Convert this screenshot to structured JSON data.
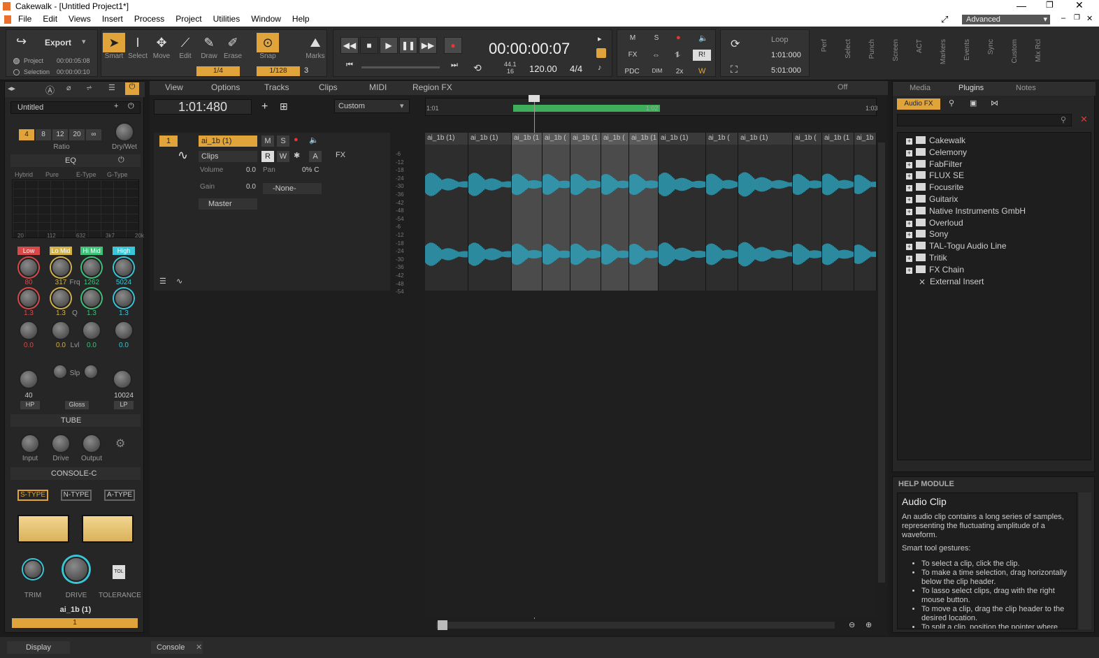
{
  "window": {
    "title": "Cakewalk - [Untitled Project1*]"
  },
  "menu": [
    "File",
    "Edit",
    "Views",
    "Insert",
    "Process",
    "Project",
    "Utilities",
    "Window",
    "Help"
  ],
  "workspace": "Advanced",
  "control": {
    "export_label": "Export",
    "project_label": "Project",
    "project_time": "00:00:05:08",
    "selection_label": "Selection",
    "selection_time": "00:00:00:10",
    "tools": [
      "Smart",
      "Select",
      "Move",
      "Edit",
      "Draw",
      "Erase"
    ],
    "snap_label": "Snap",
    "marks_label": "Marks",
    "draw_res": "1/4",
    "snap_res": "1/128",
    "snap_num": "3",
    "time": "00:00:00:07",
    "sample_rate": "44.1",
    "bit_depth": "16",
    "tempo": "120.00",
    "meter": "4/4",
    "mix_buttons": [
      "M",
      "S",
      "FX",
      "PDC",
      "DIM",
      "2x",
      "R!"
    ],
    "loop_label": "Loop",
    "loop_start": "1:01:000",
    "loop_end": "5:01:000",
    "vtabs": [
      "Perf",
      "Select",
      "Punch",
      "Screen",
      "ACT",
      "Markers",
      "Events",
      "Sync",
      "Custom",
      "Mix Rcl"
    ]
  },
  "inspector": {
    "project_name": "Untitled",
    "ratio_buttons": [
      "4",
      "8",
      "12",
      "20",
      "∞"
    ],
    "ratio_label": "Ratio",
    "drywet_label": "Dry/Wet",
    "eq_label": "EQ",
    "eq_modes": [
      "Hybrid",
      "Pure",
      "E-Type",
      "G-Type"
    ],
    "eq_freq_ticks": [
      "20",
      "112",
      "632",
      "3k7",
      "20k"
    ],
    "bands": [
      "Low",
      "Lo Mid",
      "Hi Mid",
      "High"
    ],
    "band_colors": [
      "#d84a4a",
      "#d2b24a",
      "#3ec27a",
      "#39c6d6"
    ],
    "freq_values": [
      "80",
      "317",
      "1262",
      "5024"
    ],
    "freq_label": "Frq",
    "q_values": [
      "1.3",
      "1.3",
      "1.3",
      "1.3"
    ],
    "q_label": "Q",
    "lvl_values": [
      "0.0",
      "0.0",
      "0.0",
      "0.0"
    ],
    "lvl_label": "Lvl",
    "slp_label": "Slp",
    "hp_value": "40",
    "lp_value": "10024",
    "hp_label": "HP",
    "gloss_label": "Gloss",
    "lp_label": "LP",
    "tube_label": "TUBE",
    "tube_knobs": [
      "Input",
      "Drive",
      "Output"
    ],
    "console_label": "CONSOLE-C",
    "console_types": [
      "S-TYPE",
      "N-TYPE",
      "A-TYPE"
    ],
    "bottom_knobs": [
      "TRIM",
      "DRIVE",
      "TOLERANCE"
    ],
    "tol_label": "TOL",
    "track_name": "ai_1b (1)",
    "track_number": "1",
    "display_tab": "Display"
  },
  "tracks": {
    "time_display": "1:01:480",
    "menus": [
      "View",
      "Options",
      "Tracks",
      "Clips",
      "MIDI",
      "Region FX"
    ],
    "preset": "Custom",
    "off_label": "Off",
    "ruler_start": "1:01",
    "ruler_mid": "1:02",
    "ruler_end": "1:03",
    "track": {
      "number": "1",
      "name": "ai_1b (1)",
      "clips_label": "Clips",
      "fx_label": "FX",
      "volume_label": "Volume",
      "volume": "0.0",
      "pan_label": "Pan",
      "pan": "0% C",
      "gain_label": "Gain",
      "gain": "0.0",
      "input": "-None-",
      "output": "Master",
      "buttons": [
        "M",
        "S",
        "R",
        "W",
        "A"
      ]
    },
    "db_scale": [
      "-6",
      "-12",
      "-18",
      "-24",
      "-30",
      "-36",
      "-42",
      "-48",
      "-54",
      "-6",
      "-12",
      "-18",
      "-24",
      "-30",
      "-36",
      "-42",
      "-48",
      "-54"
    ],
    "clips": [
      {
        "label": "ai_1b (1)"
      },
      {
        "label": "ai_1b (1)"
      },
      {
        "label": "ai_1b (1"
      },
      {
        "label": "ai_1b ("
      },
      {
        "label": "ai_1b (1"
      },
      {
        "label": "ai_1b ("
      },
      {
        "label": "ai_1b (1"
      },
      {
        "label": "ai_1b (1)"
      },
      {
        "label": "ai_1b ("
      },
      {
        "label": "ai_1b (1)"
      },
      {
        "label": "ai_1b ("
      },
      {
        "label": "ai_1b (1"
      },
      {
        "label": "ai_1b"
      }
    ]
  },
  "browser": {
    "tabs": [
      "Media",
      "Plugins",
      "Notes"
    ],
    "subtab": "Audio FX",
    "items": [
      "Cakewalk",
      "Celemony",
      "FabFilter",
      "FLUX SE",
      "Focusrite",
      "Guitarix",
      "Native Instruments GmbH",
      "Overloud",
      "Sony",
      "TAL-Togu Audio Line",
      "Tritik",
      "FX Chain",
      "External Insert"
    ]
  },
  "help": {
    "header": "HELP MODULE",
    "title": "Audio Clip",
    "body": "An audio clip contains a long series of samples, representing the fluctuating amplitude of a waveform.",
    "sub": "Smart tool gestures:",
    "bullets": [
      "To select a clip, click the clip.",
      "To make a time selection, drag horizontally below the clip header.",
      "To lasso select clips, drag with the right mouse button.",
      "To move a clip, drag the clip header to the desired location.",
      "To split a clip, position the pointer where"
    ]
  },
  "bottom": {
    "console_tab": "Console"
  },
  "colors": {
    "accent": "#e0a43a",
    "waveform": "#2bb1cf",
    "selected_clip": "#4b4b4b"
  }
}
